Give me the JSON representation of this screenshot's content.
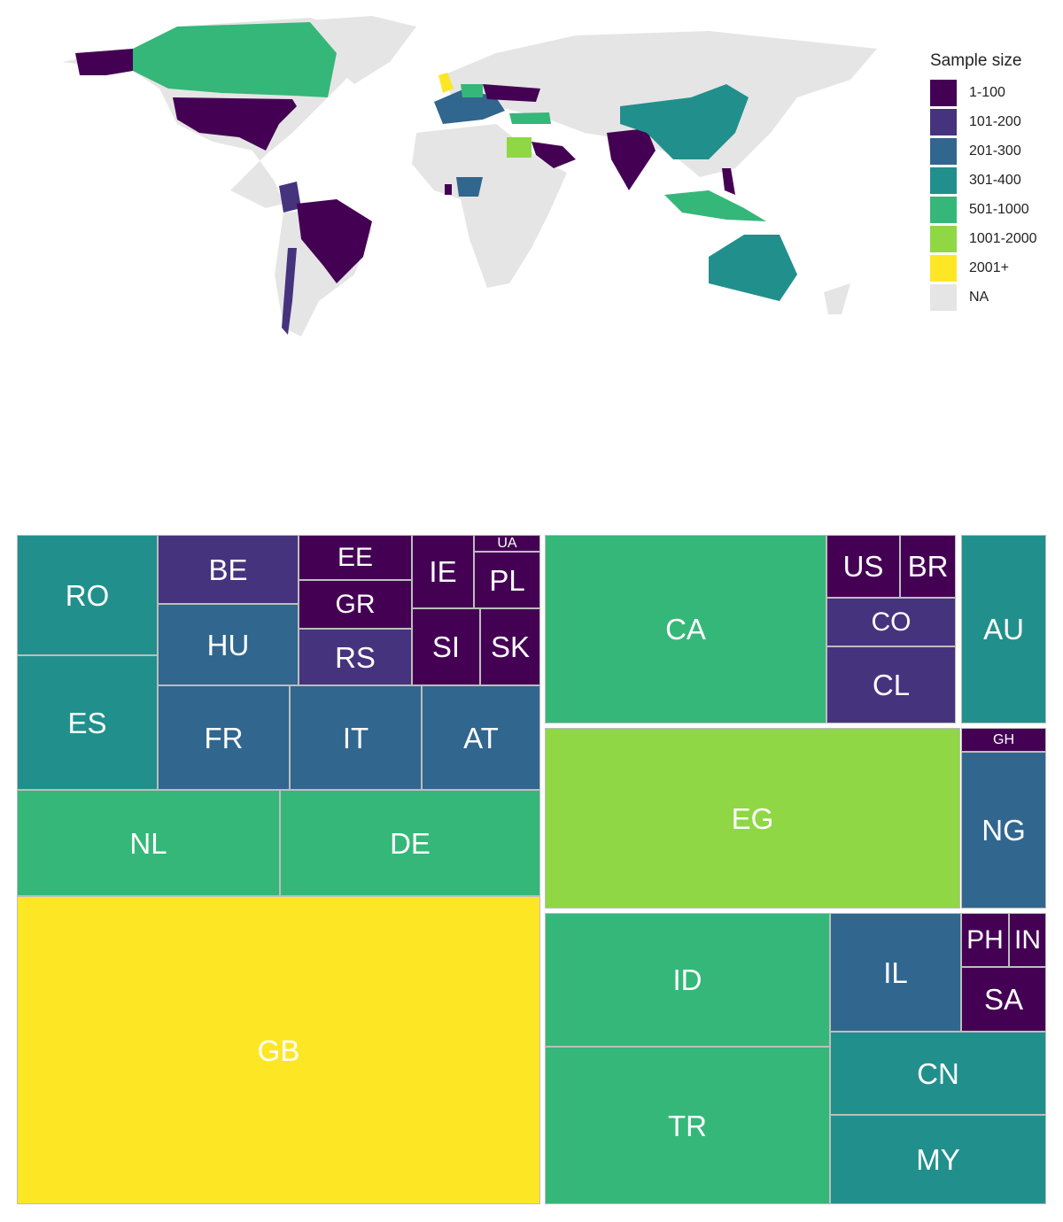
{
  "chart_data": [
    {
      "type": "choropleth-map",
      "legend": {
        "title": "Sample size",
        "placement": "right"
      },
      "bins": [
        {
          "label": "1-100",
          "color": "#440154"
        },
        {
          "label": "101-200",
          "color": "#46337E"
        },
        {
          "label": "201-300",
          "color": "#31668E"
        },
        {
          "label": "301-400",
          "color": "#21908C"
        },
        {
          "label": "501-1000",
          "color": "#35B779"
        },
        {
          "label": "1001-2000",
          "color": "#8FD744"
        },
        {
          "label": "2001+",
          "color": "#FDE725"
        },
        {
          "label": "NA",
          "color": "#E5E5E5"
        }
      ]
    },
    {
      "type": "treemap",
      "groups": [
        {
          "cells": [
            {
              "code": "RO",
              "bin": "301-400"
            },
            {
              "code": "ES",
              "bin": "301-400"
            },
            {
              "code": "BE",
              "bin": "101-200"
            },
            {
              "code": "HU",
              "bin": "201-300"
            },
            {
              "code": "EE",
              "bin": "1-100"
            },
            {
              "code": "GR",
              "bin": "1-100"
            },
            {
              "code": "RS",
              "bin": "101-200"
            },
            {
              "code": "IE",
              "bin": "1-100"
            },
            {
              "code": "UA",
              "bin": "1-100"
            },
            {
              "code": "PL",
              "bin": "1-100"
            },
            {
              "code": "SI",
              "bin": "1-100"
            },
            {
              "code": "SK",
              "bin": "1-100"
            },
            {
              "code": "FR",
              "bin": "201-300"
            },
            {
              "code": "IT",
              "bin": "201-300"
            },
            {
              "code": "AT",
              "bin": "201-300"
            },
            {
              "code": "NL",
              "bin": "501-1000"
            },
            {
              "code": "DE",
              "bin": "501-1000"
            },
            {
              "code": "GB",
              "bin": "2001+"
            }
          ]
        },
        {
          "cells": [
            {
              "code": "CA",
              "bin": "501-1000"
            },
            {
              "code": "US",
              "bin": "1-100"
            },
            {
              "code": "BR",
              "bin": "1-100"
            },
            {
              "code": "CO",
              "bin": "101-200"
            },
            {
              "code": "CL",
              "bin": "101-200"
            }
          ]
        },
        {
          "cells": [
            {
              "code": "AU",
              "bin": "301-400"
            }
          ]
        },
        {
          "cells": [
            {
              "code": "EG",
              "bin": "1001-2000"
            }
          ]
        },
        {
          "cells": [
            {
              "code": "GH",
              "bin": "1-100"
            },
            {
              "code": "NG",
              "bin": "201-300"
            }
          ]
        },
        {
          "cells": [
            {
              "code": "ID",
              "bin": "501-1000"
            },
            {
              "code": "TR",
              "bin": "501-1000"
            },
            {
              "code": "IL",
              "bin": "201-300"
            },
            {
              "code": "PH",
              "bin": "1-100"
            },
            {
              "code": "IN",
              "bin": "1-100"
            },
            {
              "code": "SA",
              "bin": "1-100"
            },
            {
              "code": "CN",
              "bin": "301-400"
            },
            {
              "code": "MY",
              "bin": "301-400"
            }
          ]
        }
      ]
    }
  ]
}
